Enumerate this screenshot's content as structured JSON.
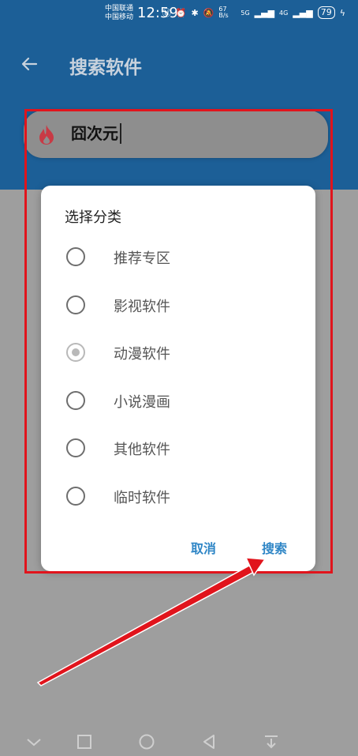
{
  "status_bar": {
    "carrier_1": "中国联通",
    "carrier_2": "中国移动",
    "time": "12:59",
    "net_speed": "67 B/s",
    "signal_1": "5G",
    "signal_2": "4G",
    "battery": "79"
  },
  "toolbar": {
    "title": "搜索软件"
  },
  "search": {
    "value": "囧次元"
  },
  "dialog": {
    "title": "选择分类",
    "options": [
      {
        "label": "推荐专区",
        "checked": false
      },
      {
        "label": "影视软件",
        "checked": false
      },
      {
        "label": "动漫软件",
        "checked": true
      },
      {
        "label": "小说漫画",
        "checked": false
      },
      {
        "label": "其他软件",
        "checked": false
      },
      {
        "label": "临时软件",
        "checked": false
      }
    ],
    "cancel_label": "取消",
    "search_label": "搜索"
  },
  "colors": {
    "header": "#1c5f97",
    "accent": "#2f86c6",
    "highlight": "#e1141c"
  }
}
